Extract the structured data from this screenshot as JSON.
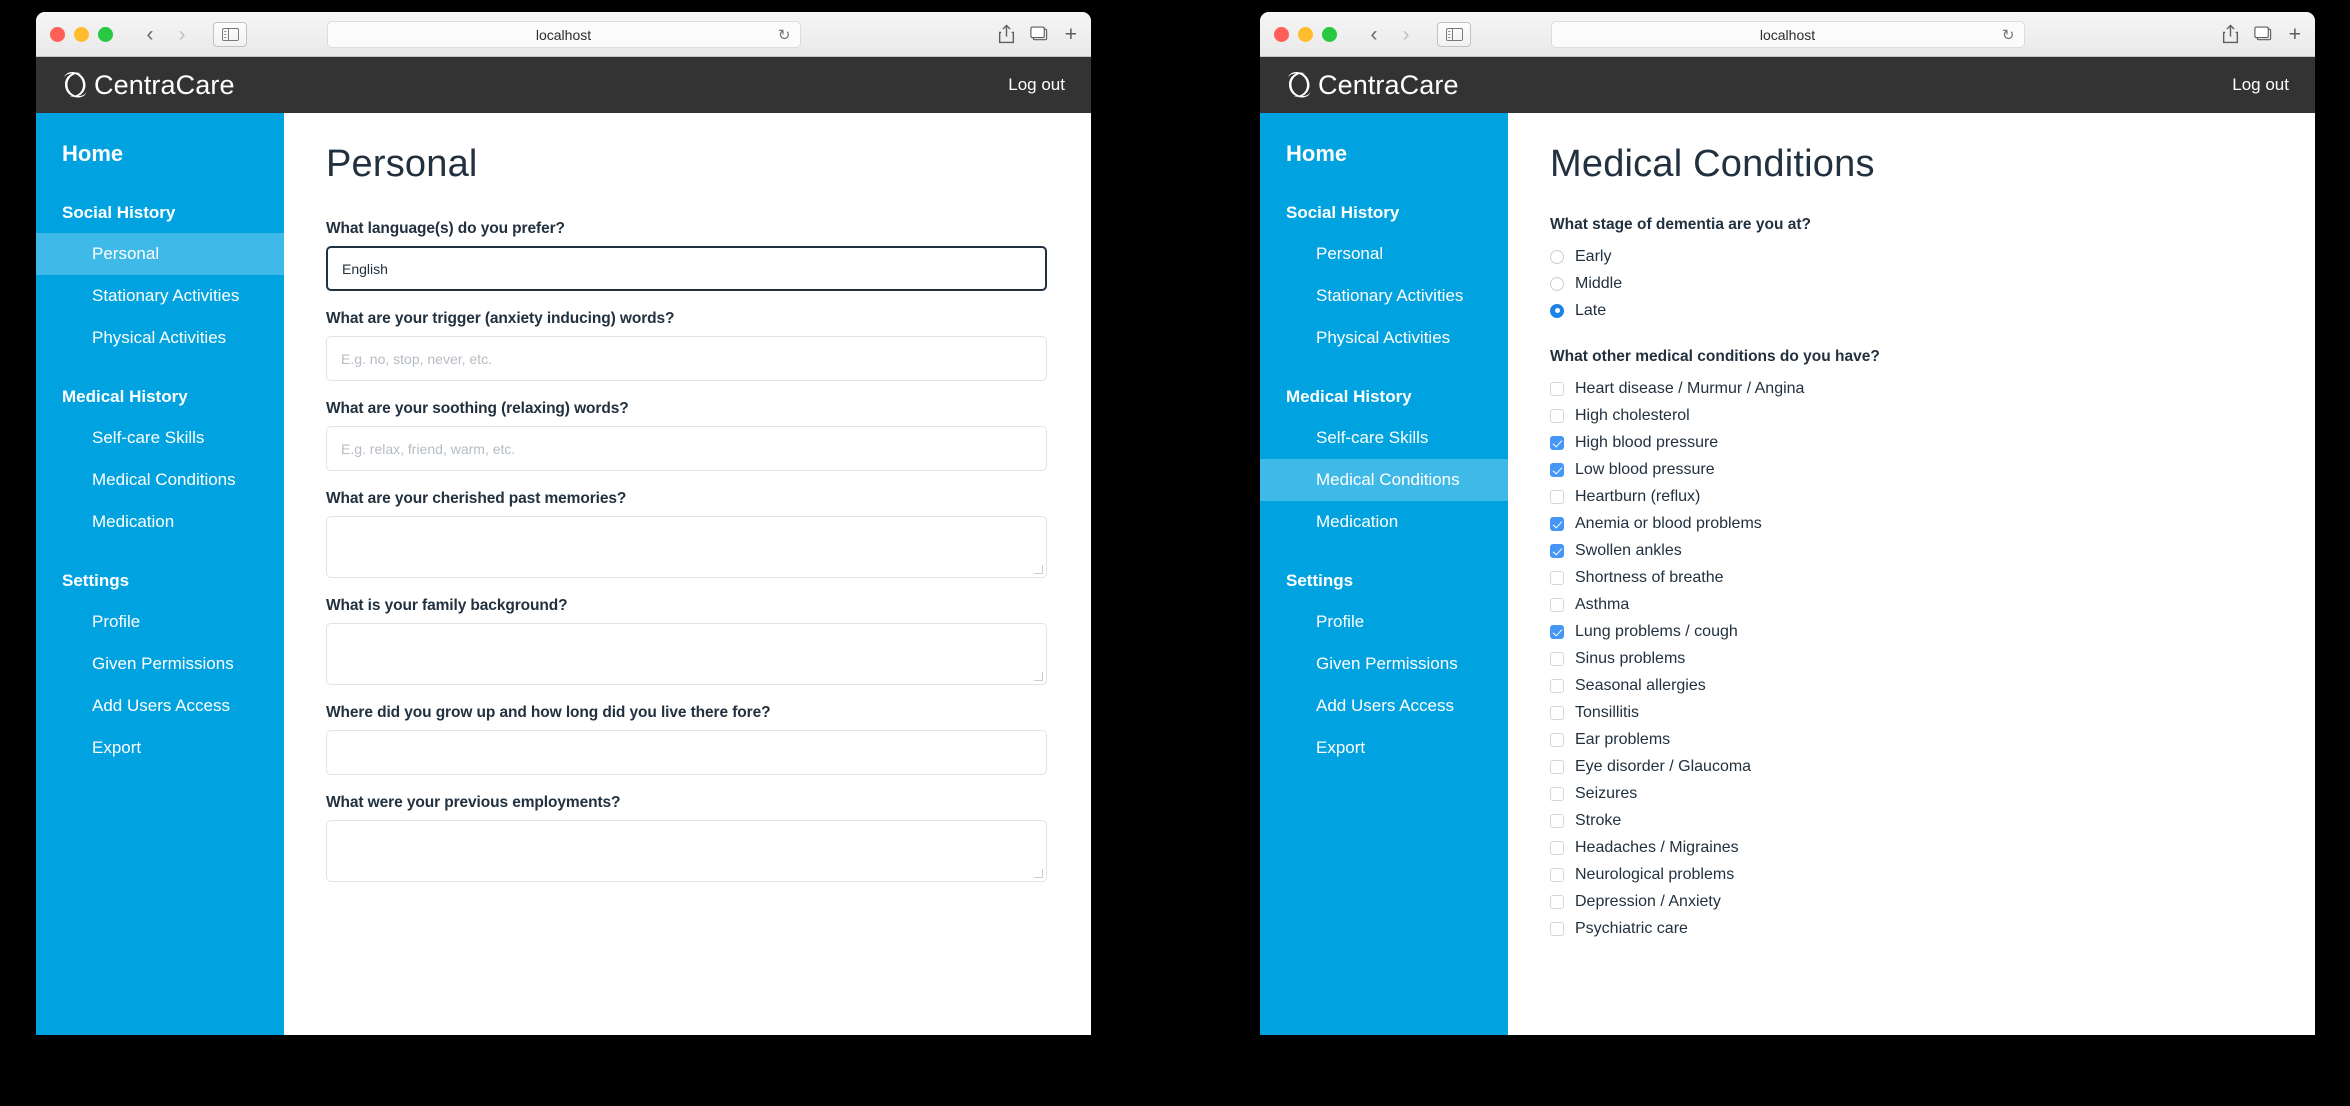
{
  "browser": {
    "url": "localhost",
    "back_icon": "chevron-left-icon",
    "forward_icon": "chevron-right-icon",
    "sidebar_icon": "sidebar-toggle-icon",
    "reload_icon": "reload-icon",
    "share_icon": "share-icon",
    "tabs_icon": "tab-overview-icon",
    "new_tab_icon": "plus-icon",
    "traffic": {
      "close": "close-window-button",
      "minimize": "minimize-window-button",
      "zoom": "zoom-window-button"
    }
  },
  "app": {
    "brand": "CentraCare",
    "logo_icon": "spiral-c-logo-icon",
    "logout": "Log out",
    "colors": {
      "header_bg": "#333333",
      "sidebar_bg": "#00A3E0",
      "sidebar_active_bg": "#3FB9E8",
      "text_dark": "#22313f",
      "accent_blue": "#1d83e8",
      "checkbox_blue": "#4596f5"
    }
  },
  "sidebar": {
    "home": "Home",
    "sections": [
      {
        "title": "Social History",
        "items": [
          {
            "label": "Personal",
            "active_left": true,
            "active_right": false
          },
          {
            "label": "Stationary Activities",
            "active_left": false,
            "active_right": false
          },
          {
            "label": "Physical Activities",
            "active_left": false,
            "active_right": false
          }
        ]
      },
      {
        "title": "Medical History",
        "items": [
          {
            "label": "Self-care Skills",
            "active_left": false,
            "active_right": false
          },
          {
            "label": "Medical Conditions",
            "active_left": false,
            "active_right": true
          },
          {
            "label": "Medication",
            "active_left": false,
            "active_right": false
          }
        ]
      },
      {
        "title": "Settings",
        "items": [
          {
            "label": "Profile",
            "active_left": false,
            "active_right": false
          },
          {
            "label": "Given Permissions",
            "active_left": false,
            "active_right": false
          },
          {
            "label": "Add Users Access",
            "active_left": false,
            "active_right": false
          },
          {
            "label": "Export",
            "active_left": false,
            "active_right": false
          }
        ]
      }
    ]
  },
  "left_page": {
    "title": "Personal",
    "fields": [
      {
        "label": "What language(s) do you prefer?",
        "type": "input",
        "value": "English",
        "placeholder": "",
        "filled": true
      },
      {
        "label": "What are your trigger (anxiety inducing) words?",
        "type": "input",
        "value": "",
        "placeholder": "E.g. no, stop, never, etc.",
        "filled": false
      },
      {
        "label": "What are your soothing (relaxing) words?",
        "type": "input",
        "value": "",
        "placeholder": "E.g. relax, friend, warm, etc.",
        "filled": false
      },
      {
        "label": "What are your cherished past memories?",
        "type": "textarea",
        "value": "",
        "placeholder": "",
        "filled": false
      },
      {
        "label": "What is your family background?",
        "type": "textarea",
        "value": "",
        "placeholder": "",
        "filled": false
      },
      {
        "label": "Where did you grow up and how long did you live there fore?",
        "type": "input",
        "value": "",
        "placeholder": "",
        "filled": false
      },
      {
        "label": "What were your previous employments?",
        "type": "textarea",
        "value": "",
        "placeholder": "",
        "filled": false
      }
    ]
  },
  "right_page": {
    "title": "Medical Conditions",
    "stage_question": "What stage of dementia are you at?",
    "stage_options": [
      {
        "label": "Early",
        "selected": false
      },
      {
        "label": "Middle",
        "selected": false
      },
      {
        "label": "Late",
        "selected": true
      }
    ],
    "conditions_question": "What other medical conditions do you have?",
    "conditions": [
      {
        "label": "Heart disease / Murmur / Angina",
        "checked": false
      },
      {
        "label": "High cholesterol",
        "checked": false
      },
      {
        "label": "High blood pressure",
        "checked": true
      },
      {
        "label": "Low blood pressure",
        "checked": true
      },
      {
        "label": "Heartburn (reflux)",
        "checked": false
      },
      {
        "label": "Anemia or blood problems",
        "checked": true
      },
      {
        "label": "Swollen ankles",
        "checked": true
      },
      {
        "label": "Shortness of breathe",
        "checked": false
      },
      {
        "label": "Asthma",
        "checked": false
      },
      {
        "label": "Lung problems / cough",
        "checked": true
      },
      {
        "label": "Sinus problems",
        "checked": false
      },
      {
        "label": "Seasonal allergies",
        "checked": false
      },
      {
        "label": "Tonsillitis",
        "checked": false
      },
      {
        "label": "Ear problems",
        "checked": false
      },
      {
        "label": "Eye disorder / Glaucoma",
        "checked": false
      },
      {
        "label": "Seizures",
        "checked": false
      },
      {
        "label": "Stroke",
        "checked": false
      },
      {
        "label": "Headaches / Migraines",
        "checked": false
      },
      {
        "label": "Neurological problems",
        "checked": false
      },
      {
        "label": "Depression / Anxiety",
        "checked": false
      },
      {
        "label": "Psychiatric care",
        "checked": false
      }
    ]
  }
}
